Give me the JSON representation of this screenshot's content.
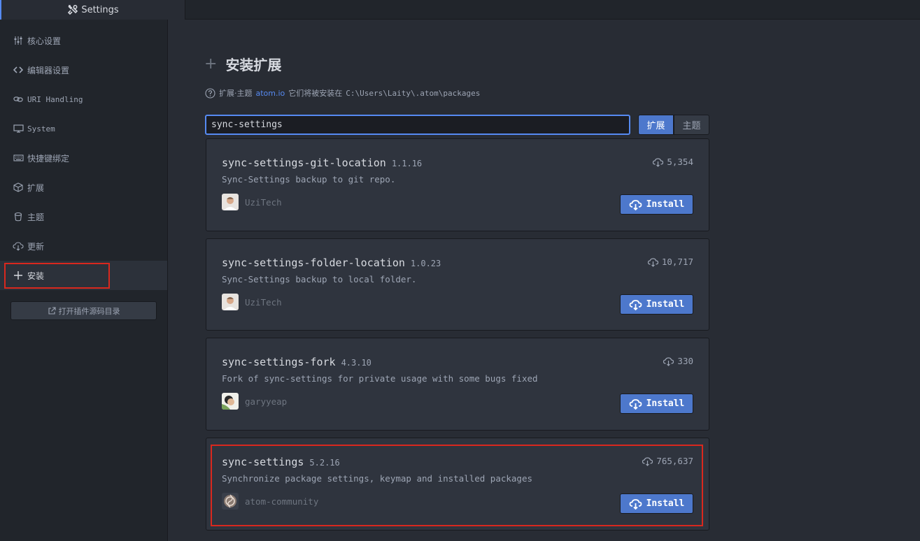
{
  "tab": {
    "title": "Settings",
    "icon": "tools-icon"
  },
  "sidebar": {
    "items": [
      {
        "label": "核心设置",
        "icon": "sliders-icon"
      },
      {
        "label": "编辑器设置",
        "icon": "code-icon"
      },
      {
        "label": "URI Handling",
        "icon": "link-icon"
      },
      {
        "label": "System",
        "icon": "monitor-icon"
      },
      {
        "label": "快捷键绑定",
        "icon": "keyboard-icon"
      },
      {
        "label": "扩展",
        "icon": "package-icon"
      },
      {
        "label": "主题",
        "icon": "paintcan-icon"
      },
      {
        "label": "更新",
        "icon": "cloud-download-icon"
      },
      {
        "label": "安装",
        "icon": "plus-icon",
        "active": true
      }
    ],
    "open_dir_button": "打开插件源码目录"
  },
  "main": {
    "section_title": "安装扩展",
    "hint": {
      "prefix": "扩展·主题",
      "link": "atom.io",
      "middle": "它们将被安装在",
      "path": "C:\\Users\\Laity\\.atom\\packages"
    },
    "search": {
      "value": "sync-settings"
    },
    "toggle": {
      "packages_label": "扩展",
      "themes_label": "主题",
      "selected": "扩展"
    },
    "packages": [
      {
        "name": "sync-settings-git-location",
        "version": "1.1.16",
        "description": "Sync-Settings backup to git repo.",
        "owner": "UziTech",
        "downloads": "5,354",
        "install_label": "Install"
      },
      {
        "name": "sync-settings-folder-location",
        "version": "1.0.23",
        "description": "Sync-Settings backup to local folder.",
        "owner": "UziTech",
        "downloads": "10,717",
        "install_label": "Install"
      },
      {
        "name": "sync-settings-fork",
        "version": "4.3.10",
        "description": "Fork of sync-settings for private usage with some bugs fixed",
        "owner": "garyyeap",
        "downloads": "330",
        "install_label": "Install"
      },
      {
        "name": "sync-settings",
        "version": "5.2.16",
        "description": "Synchronize package settings, keymap and installed packages",
        "owner": "atom-community",
        "downloads": "765,637",
        "install_label": "Install"
      }
    ]
  },
  "colors": {
    "accent": "#4d78cc",
    "highlight_annotation": "#d9281e",
    "background": "#282c34",
    "sidebar": "#21252b"
  }
}
